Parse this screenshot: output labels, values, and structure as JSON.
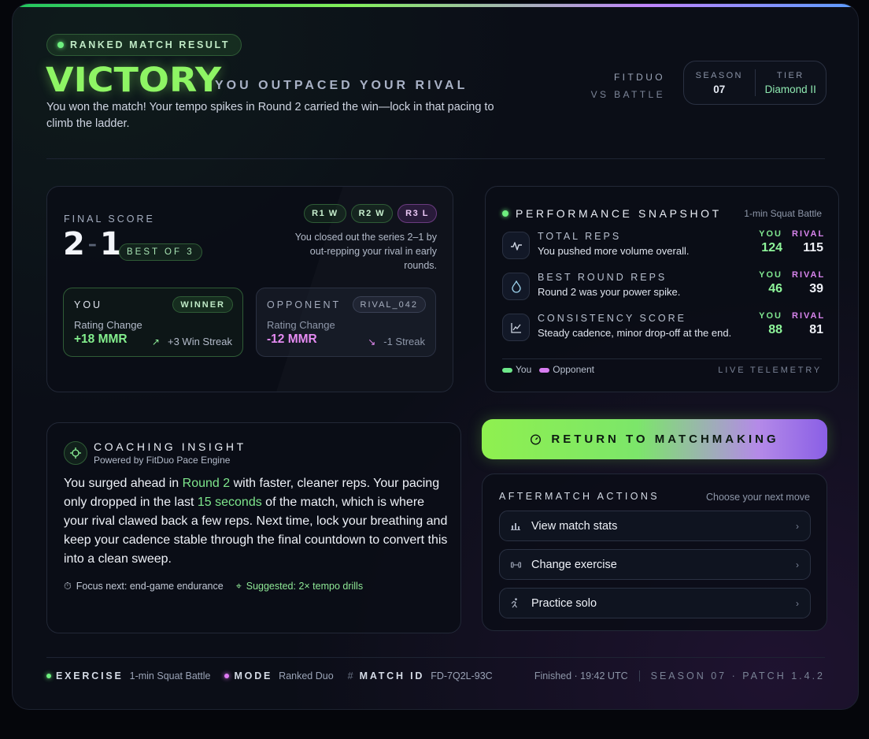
{
  "header": {
    "badge": "RANKED MATCH RESULT",
    "result": "VICTORY",
    "tagline": "YOU OUTPACED YOUR RIVAL",
    "description": "You won the match! Your tempo spikes in Round 2 carried the win—lock in that pacing to climb the ladder.",
    "brand_line1": "FITDUO",
    "brand_line2": "VS BATTLE",
    "season_label": "SEASON",
    "season_value": "07",
    "tier_label": "TIER",
    "tier_value": "Diamond II"
  },
  "score": {
    "label": "FINAL SCORE",
    "you": "2",
    "dash": "–",
    "rival": "1",
    "best_of": "BEST OF 3",
    "rounds": [
      {
        "label": "R1 W",
        "result": "win"
      },
      {
        "label": "R2 W",
        "result": "win"
      },
      {
        "label": "R3 L",
        "result": "loss"
      }
    ],
    "note": "You closed out the series 2–1 by out-repping your rival in early rounds.",
    "you_side": {
      "name": "YOU",
      "pill": "WINNER",
      "rating_label": "Rating Change",
      "mmr": "+18 MMR",
      "streak": "+3 Win Streak"
    },
    "opp_side": {
      "name": "OPPONENT",
      "pill": "RIVAL_042",
      "rating_label": "Rating Change",
      "mmr": "-12 MMR",
      "streak": "-1 Streak"
    }
  },
  "performance": {
    "title": "PERFORMANCE SNAPSHOT",
    "subtitle": "1-min Squat Battle",
    "you_key": "YOU",
    "rival_key": "RIVAL",
    "metrics": [
      {
        "title": "TOTAL REPS",
        "desc": "You pushed more volume overall.",
        "you": "124",
        "rival": "115",
        "icon": "pulse-icon"
      },
      {
        "title": "BEST ROUND REPS",
        "desc": "Round 2 was your power spike.",
        "you": "46",
        "rival": "39",
        "icon": "flame-icon"
      },
      {
        "title": "CONSISTENCY SCORE",
        "desc": "Steady cadence, minor drop-off at the end.",
        "you": "88",
        "rival": "81",
        "icon": "chart-icon"
      }
    ],
    "legend_you": "You",
    "legend_opp": "Opponent",
    "live": "LIVE TELEMETRY"
  },
  "coaching": {
    "title": "COACHING INSIGHT",
    "subtitle": "Powered by FitDuo Pace Engine",
    "body_1": "You surged ahead in ",
    "body_hl1": "Round 2",
    "body_2": " with faster, cleaner reps. Your pacing only dropped in the last ",
    "body_hl2": "15 seconds",
    "body_3": " of the match, which is where your rival clawed back a few reps. Next time, lock your breathing and keep your cadence stable through the final countdown to convert this into a clean sweep.",
    "focus": "Focus next: end-game endurance",
    "suggested": "Suggested: 2× tempo drills"
  },
  "return_button": "RETURN TO MATCHMAKING",
  "after": {
    "title": "AFTERMATCH ACTIONS",
    "subtitle": "Choose your next move",
    "actions": [
      {
        "label": "View match stats",
        "icon": "bar-chart-icon"
      },
      {
        "label": "Change exercise",
        "icon": "dumbbell-icon"
      },
      {
        "label": "Practice solo",
        "icon": "runner-icon"
      }
    ]
  },
  "footer": {
    "exercise_key": "EXERCISE",
    "exercise_val": "1-min Squat Battle",
    "mode_key": "MODE",
    "mode_val": "Ranked Duo",
    "match_key": "MATCH ID",
    "match_val": "FD-7Q2L-93C",
    "finished": "Finished · 19:42 UTC",
    "patch": "SEASON 07 · PATCH 1.4.2"
  },
  "colors": {
    "accent_green": "#8ef564",
    "accent_pink": "#e58bf2",
    "background": "#0b0e17"
  }
}
